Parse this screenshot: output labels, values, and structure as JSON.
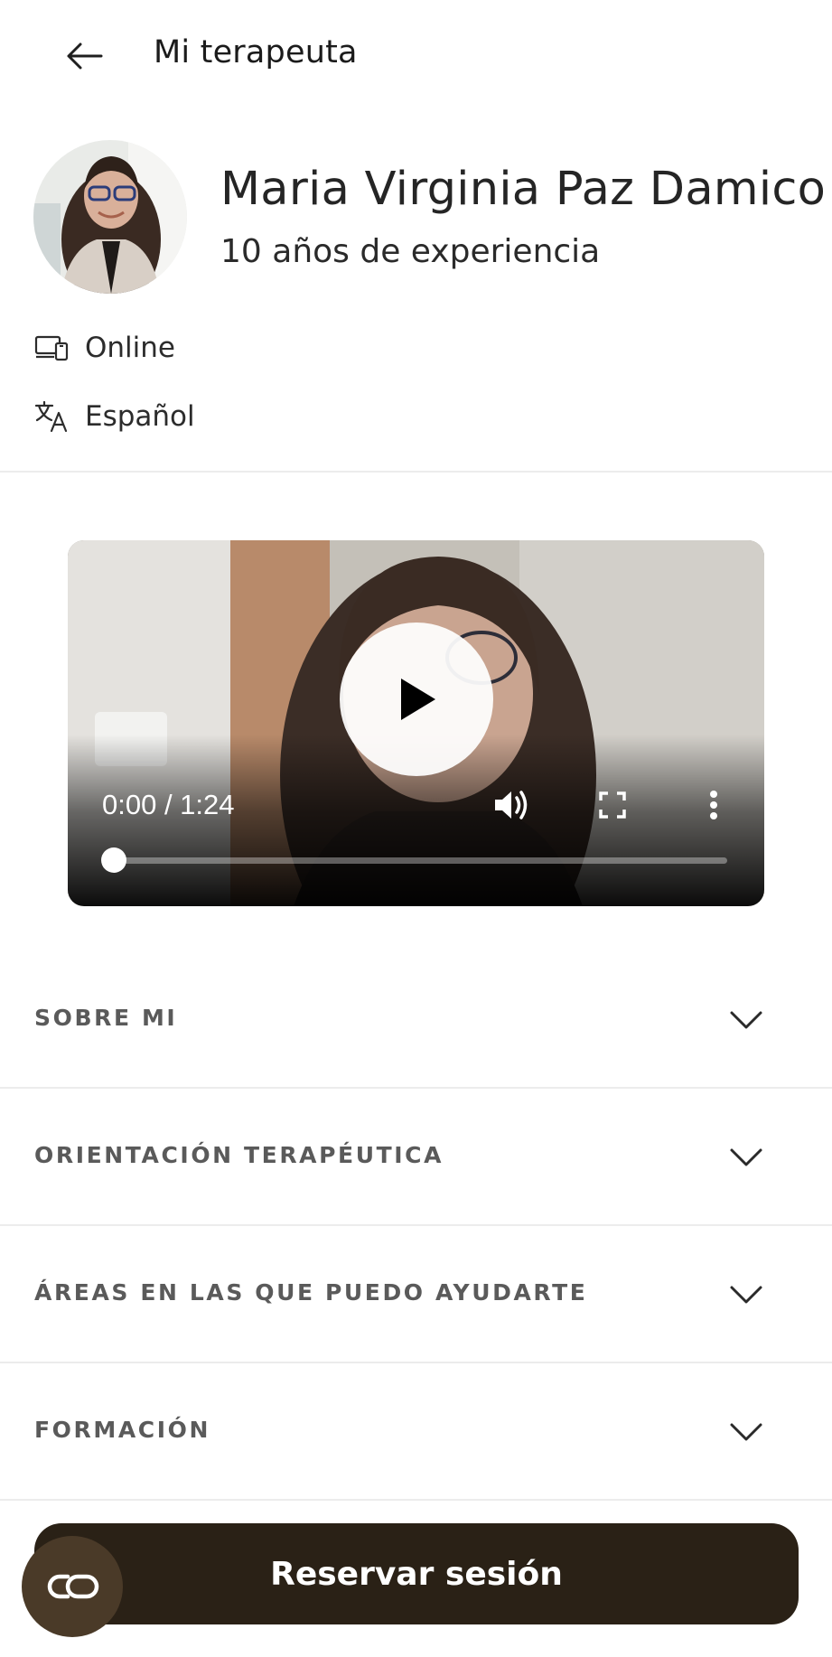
{
  "header": {
    "title": "Mi terapeuta",
    "back_icon": "arrow-left-icon"
  },
  "profile": {
    "name": "Maria Virginia Paz Damico",
    "experience": "10 años de experiencia",
    "modality": "Online",
    "language": "Español"
  },
  "video": {
    "time": "0:00 / 1:24",
    "progress": 0
  },
  "sections": [
    {
      "label": "SOBRE MI"
    },
    {
      "label": "ORIENTACIÓN TERAPÉUTICA"
    },
    {
      "label": "ÁREAS EN LAS QUE PUEDO AYUDARTE"
    },
    {
      "label": "FORMACIÓN"
    }
  ],
  "cta": {
    "label": "Reservar sesión"
  },
  "colors": {
    "cta_background": "#2a2116",
    "fab_background": "#4a3a28",
    "section_label": "#5a5a5a"
  }
}
